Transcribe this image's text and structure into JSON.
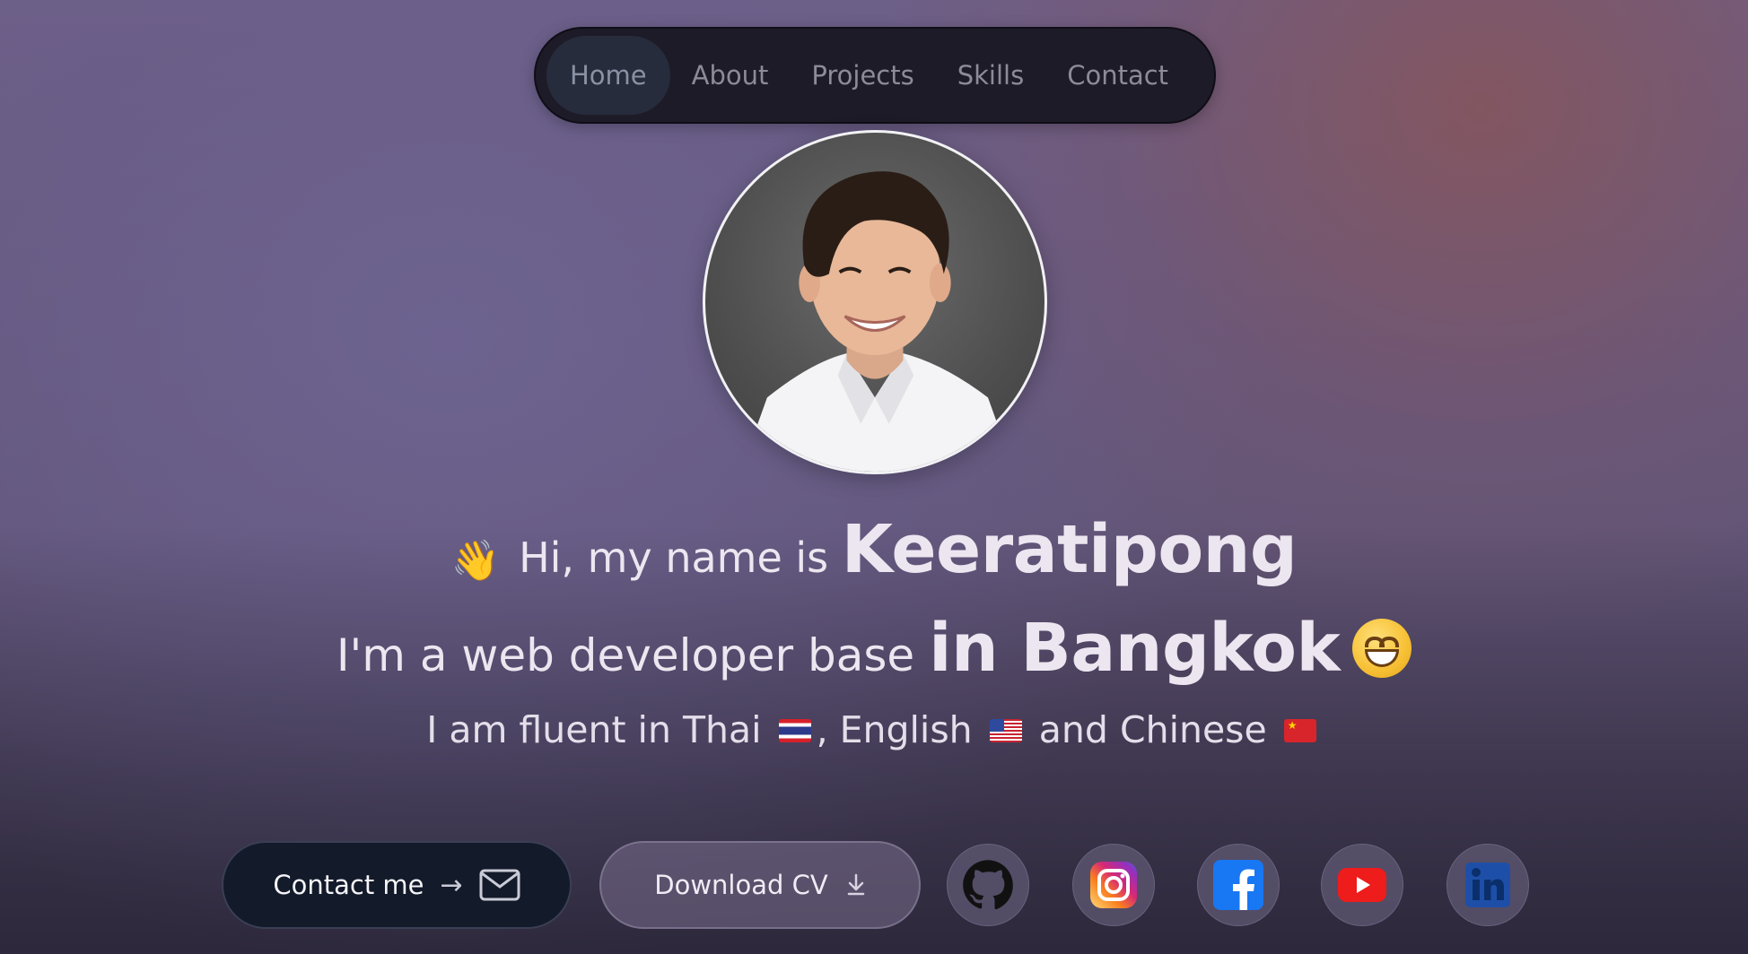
{
  "nav": {
    "items": [
      {
        "label": "Home",
        "active": true
      },
      {
        "label": "About"
      },
      {
        "label": "Projects"
      },
      {
        "label": "Skills"
      },
      {
        "label": "Contact"
      }
    ]
  },
  "avatar": {
    "icon": "portrait-photo"
  },
  "hero": {
    "line1_prefix": "Hi, my name is",
    "line1_name": "Keeratipong",
    "line2_prefix": "I'm a web developer base",
    "line2_city": "in Bangkok",
    "line3_part1": "I am fluent in Thai",
    "line3_part2": ", English",
    "line3_part3": "and Chinese",
    "wave_emoji": "👋",
    "grin_emoji": "grinning-face-icon"
  },
  "actions": {
    "contact_label": "Contact me",
    "contact_arrow": "→",
    "cv_label": "Download CV"
  },
  "socials": [
    {
      "name": "github",
      "color": "#111111"
    },
    {
      "name": "instagram",
      "color": "#d62976"
    },
    {
      "name": "facebook",
      "color": "#1877f2"
    },
    {
      "name": "youtube",
      "color": "#ff0000"
    },
    {
      "name": "linkedin",
      "color": "#0a66c2"
    }
  ]
}
